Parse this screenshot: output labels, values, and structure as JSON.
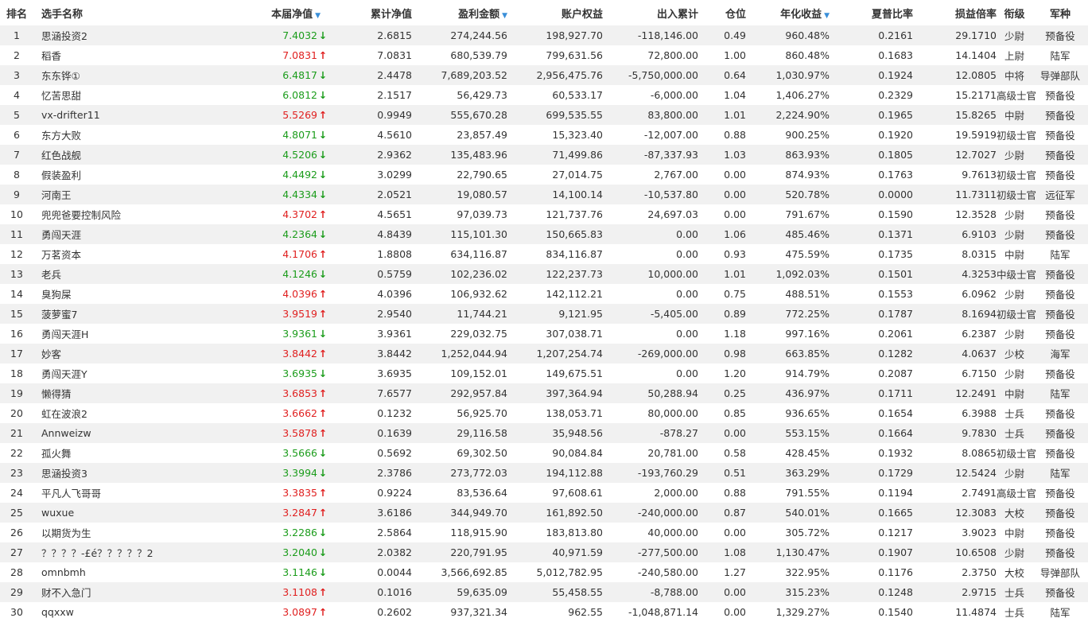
{
  "colors": {
    "up": "#e01f1f",
    "down": "#1b9c1b",
    "sort_indicator": "#3a8fd9",
    "row_alt": "#f1f1f1"
  },
  "header": {
    "rank": "排名",
    "name": "选手名称",
    "current_nav": "本届净值",
    "cumulative_nav": "累计净值",
    "profit": "盈利金额",
    "equity": "账户权益",
    "inout": "出入累计",
    "position": "仓位",
    "annual": "年化收益",
    "sharpe": "夏普比率",
    "pl_ratio": "损益倍率",
    "rank_title": "衔级",
    "branch": "军种"
  },
  "sorted_columns": [
    "current_nav",
    "profit",
    "annual"
  ],
  "rows": [
    {
      "rank": "1",
      "name": "思涵投资2",
      "nav": "7.4032",
      "trend": "down",
      "cum": "2.6815",
      "profit": "274,244.56",
      "equity": "198,927.70",
      "inout": "-118,146.00",
      "pos": "0.49",
      "annual": "960.48%",
      "sharpe": "0.2161",
      "ratio": "29.1710",
      "title": "少尉",
      "branch": "预备役"
    },
    {
      "rank": "2",
      "name": "稻香",
      "nav": "7.0831",
      "trend": "up",
      "cum": "7.0831",
      "profit": "680,539.79",
      "equity": "799,631.56",
      "inout": "72,800.00",
      "pos": "1.00",
      "annual": "860.48%",
      "sharpe": "0.1683",
      "ratio": "14.1404",
      "title": "上尉",
      "branch": "陆军"
    },
    {
      "rank": "3",
      "name": "东东铧①",
      "nav": "6.4817",
      "trend": "down",
      "cum": "2.4478",
      "profit": "7,689,203.52",
      "equity": "2,956,475.76",
      "inout": "-5,750,000.00",
      "pos": "0.64",
      "annual": "1,030.97%",
      "sharpe": "0.1924",
      "ratio": "12.0805",
      "title": "中将",
      "branch": "导弹部队"
    },
    {
      "rank": "4",
      "name": "忆苦思甜",
      "nav": "6.0812",
      "trend": "down",
      "cum": "2.1517",
      "profit": "56,429.73",
      "equity": "60,533.17",
      "inout": "-6,000.00",
      "pos": "1.04",
      "annual": "1,406.27%",
      "sharpe": "0.2329",
      "ratio": "15.2171",
      "title": "高级士官",
      "branch": "预备役"
    },
    {
      "rank": "5",
      "name": "vx-drifter11",
      "nav": "5.5269",
      "trend": "up",
      "cum": "0.9949",
      "profit": "555,670.28",
      "equity": "699,535.55",
      "inout": "83,800.00",
      "pos": "1.01",
      "annual": "2,224.90%",
      "sharpe": "0.1965",
      "ratio": "15.8265",
      "title": "中尉",
      "branch": "预备役"
    },
    {
      "rank": "6",
      "name": "东方大败",
      "nav": "4.8071",
      "trend": "down",
      "cum": "4.5610",
      "profit": "23,857.49",
      "equity": "15,323.40",
      "inout": "-12,007.00",
      "pos": "0.88",
      "annual": "900.25%",
      "sharpe": "0.1920",
      "ratio": "19.5919",
      "title": "初级士官",
      "branch": "预备役"
    },
    {
      "rank": "7",
      "name": "红色战舰",
      "nav": "4.5206",
      "trend": "down",
      "cum": "2.9362",
      "profit": "135,483.96",
      "equity": "71,499.86",
      "inout": "-87,337.93",
      "pos": "1.03",
      "annual": "863.93%",
      "sharpe": "0.1805",
      "ratio": "12.7027",
      "title": "少尉",
      "branch": "预备役"
    },
    {
      "rank": "8",
      "name": "假装盈利",
      "nav": "4.4492",
      "trend": "down",
      "cum": "3.0299",
      "profit": "22,790.65",
      "equity": "27,014.75",
      "inout": "2,767.00",
      "pos": "0.00",
      "annual": "874.93%",
      "sharpe": "0.1763",
      "ratio": "9.7613",
      "title": "初级士官",
      "branch": "预备役"
    },
    {
      "rank": "9",
      "name": "河南王",
      "nav": "4.4334",
      "trend": "down",
      "cum": "2.0521",
      "profit": "19,080.57",
      "equity": "14,100.14",
      "inout": "-10,537.80",
      "pos": "0.00",
      "annual": "520.78%",
      "sharpe": "0.0000",
      "ratio": "11.7311",
      "title": "初级士官",
      "branch": "远征军"
    },
    {
      "rank": "10",
      "name": "兜兜爸要控制风险",
      "nav": "4.3702",
      "trend": "up",
      "cum": "4.5651",
      "profit": "97,039.73",
      "equity": "121,737.76",
      "inout": "24,697.03",
      "pos": "0.00",
      "annual": "791.67%",
      "sharpe": "0.1590",
      "ratio": "12.3528",
      "title": "少尉",
      "branch": "预备役"
    },
    {
      "rank": "11",
      "name": "勇闯天涯",
      "nav": "4.2364",
      "trend": "down",
      "cum": "4.8439",
      "profit": "115,101.30",
      "equity": "150,665.83",
      "inout": "0.00",
      "pos": "1.06",
      "annual": "485.46%",
      "sharpe": "0.1371",
      "ratio": "6.9103",
      "title": "少尉",
      "branch": "预备役"
    },
    {
      "rank": "12",
      "name": "万茗资本",
      "nav": "4.1706",
      "trend": "up",
      "cum": "1.8808",
      "profit": "634,116.87",
      "equity": "834,116.87",
      "inout": "0.00",
      "pos": "0.93",
      "annual": "475.59%",
      "sharpe": "0.1735",
      "ratio": "8.0315",
      "title": "中尉",
      "branch": "陆军"
    },
    {
      "rank": "13",
      "name": "老兵",
      "nav": "4.1246",
      "trend": "down",
      "cum": "0.5759",
      "profit": "102,236.02",
      "equity": "122,237.73",
      "inout": "10,000.00",
      "pos": "1.01",
      "annual": "1,092.03%",
      "sharpe": "0.1501",
      "ratio": "4.3253",
      "title": "中级士官",
      "branch": "预备役"
    },
    {
      "rank": "14",
      "name": "臭狗屎",
      "nav": "4.0396",
      "trend": "up",
      "cum": "4.0396",
      "profit": "106,932.62",
      "equity": "142,112.21",
      "inout": "0.00",
      "pos": "0.75",
      "annual": "488.51%",
      "sharpe": "0.1553",
      "ratio": "6.0962",
      "title": "少尉",
      "branch": "预备役"
    },
    {
      "rank": "15",
      "name": "菠萝蜜7",
      "nav": "3.9519",
      "trend": "up",
      "cum": "2.9540",
      "profit": "11,744.21",
      "equity": "9,121.95",
      "inout": "-5,405.00",
      "pos": "0.89",
      "annual": "772.25%",
      "sharpe": "0.1787",
      "ratio": "8.1694",
      "title": "初级士官",
      "branch": "预备役"
    },
    {
      "rank": "16",
      "name": "勇闯天涯H",
      "nav": "3.9361",
      "trend": "down",
      "cum": "3.9361",
      "profit": "229,032.75",
      "equity": "307,038.71",
      "inout": "0.00",
      "pos": "1.18",
      "annual": "997.16%",
      "sharpe": "0.2061",
      "ratio": "6.2387",
      "title": "少尉",
      "branch": "预备役"
    },
    {
      "rank": "17",
      "name": "妙客",
      "nav": "3.8442",
      "trend": "up",
      "cum": "3.8442",
      "profit": "1,252,044.94",
      "equity": "1,207,254.74",
      "inout": "-269,000.00",
      "pos": "0.98",
      "annual": "663.85%",
      "sharpe": "0.1282",
      "ratio": "4.0637",
      "title": "少校",
      "branch": "海军"
    },
    {
      "rank": "18",
      "name": "勇闯天涯Y",
      "nav": "3.6935",
      "trend": "down",
      "cum": "3.6935",
      "profit": "109,152.01",
      "equity": "149,675.51",
      "inout": "0.00",
      "pos": "1.20",
      "annual": "914.79%",
      "sharpe": "0.2087",
      "ratio": "6.7150",
      "title": "少尉",
      "branch": "预备役"
    },
    {
      "rank": "19",
      "name": "懒得猜",
      "nav": "3.6853",
      "trend": "up",
      "cum": "7.6577",
      "profit": "292,957.84",
      "equity": "397,364.94",
      "inout": "50,288.94",
      "pos": "0.25",
      "annual": "436.97%",
      "sharpe": "0.1711",
      "ratio": "12.2491",
      "title": "中尉",
      "branch": "陆军"
    },
    {
      "rank": "20",
      "name": "虹在波浪2",
      "nav": "3.6662",
      "trend": "up",
      "cum": "0.1232",
      "profit": "56,925.70",
      "equity": "138,053.71",
      "inout": "80,000.00",
      "pos": "0.85",
      "annual": "936.65%",
      "sharpe": "0.1654",
      "ratio": "6.3988",
      "title": "士兵",
      "branch": "预备役"
    },
    {
      "rank": "21",
      "name": "Annweizw",
      "nav": "3.5878",
      "trend": "up",
      "cum": "0.1639",
      "profit": "29,116.58",
      "equity": "35,948.56",
      "inout": "-878.27",
      "pos": "0.00",
      "annual": "553.15%",
      "sharpe": "0.1664",
      "ratio": "9.7830",
      "title": "士兵",
      "branch": "预备役"
    },
    {
      "rank": "22",
      "name": "孤火舞",
      "nav": "3.5666",
      "trend": "down",
      "cum": "0.5692",
      "profit": "69,302.50",
      "equity": "90,084.84",
      "inout": "20,781.00",
      "pos": "0.58",
      "annual": "428.45%",
      "sharpe": "0.1932",
      "ratio": "8.0865",
      "title": "初级士官",
      "branch": "预备役"
    },
    {
      "rank": "23",
      "name": "思涵投资3",
      "nav": "3.3994",
      "trend": "down",
      "cum": "2.3786",
      "profit": "273,772.03",
      "equity": "194,112.88",
      "inout": "-193,760.29",
      "pos": "0.51",
      "annual": "363.29%",
      "sharpe": "0.1729",
      "ratio": "12.5424",
      "title": "少尉",
      "branch": "陆军"
    },
    {
      "rank": "24",
      "name": "平凡人飞哥哥",
      "nav": "3.3835",
      "trend": "up",
      "cum": "0.9224",
      "profit": "83,536.64",
      "equity": "97,608.61",
      "inout": "2,000.00",
      "pos": "0.88",
      "annual": "791.55%",
      "sharpe": "0.1194",
      "ratio": "2.7491",
      "title": "高级士官",
      "branch": "预备役"
    },
    {
      "rank": "25",
      "name": "wuxue",
      "nav": "3.2847",
      "trend": "up",
      "cum": "3.6186",
      "profit": "344,949.70",
      "equity": "161,892.50",
      "inout": "-240,000.00",
      "pos": "0.87",
      "annual": "540.01%",
      "sharpe": "0.1665",
      "ratio": "12.3083",
      "title": "大校",
      "branch": "预备役"
    },
    {
      "rank": "26",
      "name": "以期货为生",
      "nav": "3.2286",
      "trend": "down",
      "cum": "2.5864",
      "profit": "118,915.90",
      "equity": "183,813.80",
      "inout": "40,000.00",
      "pos": "0.00",
      "annual": "305.72%",
      "sharpe": "0.1217",
      "ratio": "3.9023",
      "title": "中尉",
      "branch": "预备役"
    },
    {
      "rank": "27",
      "name": "？？？？-£é？？？？？2",
      "nav": "3.2040",
      "trend": "down",
      "cum": "2.0382",
      "profit": "220,791.95",
      "equity": "40,971.59",
      "inout": "-277,500.00",
      "pos": "1.08",
      "annual": "1,130.47%",
      "sharpe": "0.1907",
      "ratio": "10.6508",
      "title": "少尉",
      "branch": "预备役"
    },
    {
      "rank": "28",
      "name": "omnbmh",
      "nav": "3.1146",
      "trend": "down",
      "cum": "0.0044",
      "profit": "3,566,692.85",
      "equity": "5,012,782.95",
      "inout": "-240,580.00",
      "pos": "1.27",
      "annual": "322.95%",
      "sharpe": "0.1176",
      "ratio": "2.3750",
      "title": "大校",
      "branch": "导弹部队"
    },
    {
      "rank": "29",
      "name": "财不入急门",
      "nav": "3.1108",
      "trend": "up",
      "cum": "0.1016",
      "profit": "59,635.09",
      "equity": "55,458.55",
      "inout": "-8,788.00",
      "pos": "0.00",
      "annual": "315.23%",
      "sharpe": "0.1248",
      "ratio": "2.9715",
      "title": "士兵",
      "branch": "预备役"
    },
    {
      "rank": "30",
      "name": "qqxxw",
      "nav": "3.0897",
      "trend": "up",
      "cum": "0.2602",
      "profit": "937,321.34",
      "equity": "962.55",
      "inout": "-1,048,871.14",
      "pos": "0.00",
      "annual": "1,329.27%",
      "sharpe": "0.1540",
      "ratio": "11.4874",
      "title": "士兵",
      "branch": "陆军"
    }
  ]
}
